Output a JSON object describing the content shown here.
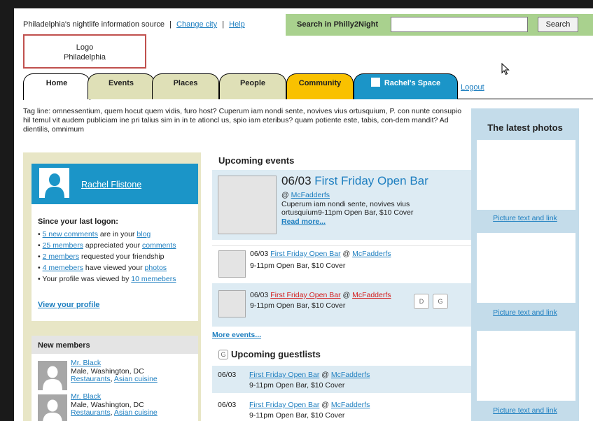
{
  "header": {
    "info_text": "Philadelphia's nightlife information source",
    "separator": "|",
    "change_city": "Change city",
    "help": "Help"
  },
  "search": {
    "label": "Search in Philly2Night",
    "placeholder": "",
    "value": "",
    "button": "Search"
  },
  "logo": {
    "line1": "Logo",
    "line2": "Philadelphia"
  },
  "tabs": [
    {
      "label": "Home",
      "color": "#ffffff"
    },
    {
      "label": "Events",
      "color": "#dfe0b7"
    },
    {
      "label": "Places",
      "color": "#dfe0b7"
    },
    {
      "label": "People",
      "color": "#dfe0b7"
    },
    {
      "label": "Community",
      "color": "#f9c100"
    },
    {
      "label": "Rachel's Space",
      "color": "#1b95c8"
    }
  ],
  "logout": "Logout",
  "tagline": "Tag line: omnessentium, quem hocut quem vidis, furo host? Cuperum iam nondi sente, novives vius ortusquium, P. con nunte consupio hil temul vit audem publiciam ine pri talius sim in in te ationcl us, spio iam eteribus? quam potiente este, tabis, con-dem mandit? Ad dientilis, omnimum",
  "profile": {
    "name": "Rachel Flistone",
    "since_title": "Since your last logon:",
    "items": [
      {
        "link1": "5 new comments",
        "mid": " are in your ",
        "link2": "blog"
      },
      {
        "link1": "25 members",
        "mid": " appreciated your ",
        "link2": "comments"
      },
      {
        "link1": "2 members",
        "mid": " requested your friendship",
        "link2": ""
      },
      {
        "link1": "4 memebers",
        "mid": " have viewed your ",
        "link2": "photos"
      },
      {
        "pre": "Your profile was viewed by ",
        "link1": "10 memebers"
      }
    ],
    "view_profile": "View your profile"
  },
  "new_members": {
    "title": "New members",
    "members": [
      {
        "name": "Mr. Black",
        "info": "Male, Washington, DC",
        "tag1": "Restaurants",
        "sep": ", ",
        "tag2": "Asian cuisine"
      },
      {
        "name": "Mr. Black",
        "info": "Male, Washington, DC",
        "tag1": "Restaurants",
        "sep": ", ",
        "tag2": "Asian cuisine"
      }
    ]
  },
  "upcoming_events": {
    "title": "Upcoming events",
    "featured": {
      "date": "06/03",
      "title": "First Friday Open Bar",
      "at": "@",
      "venue": "McFadderfs",
      "desc": "Cuperum iam nondi sente, novives vius ortusquium9-11pm Open Bar, $10 Cover",
      "read_more": "Read more..."
    },
    "events": [
      {
        "date": "06/03",
        "title": "First Friday Open Bar",
        "at": "@",
        "venue": "McFadderfs",
        "details": "9-11pm Open Bar, $10 Cover"
      },
      {
        "date": "06/03",
        "title": "First Friday Open Bar",
        "at": "@",
        "venue": "McFadderfs",
        "details": "9-11pm Open Bar, $10 Cover",
        "btn_d": "D",
        "btn_g": "G"
      }
    ],
    "more": "More events..."
  },
  "guestlists": {
    "icon": "G",
    "title": "Upcoming guestlists",
    "items": [
      {
        "date": "06/03",
        "title": "First Friday Open Bar",
        "at": "@",
        "venue": "McFadderfs",
        "details": "9-11pm Open Bar, $10 Cover"
      },
      {
        "date": "06/03",
        "title": "First Friday Open Bar",
        "at": "@",
        "venue": "McFadderfs",
        "details": "9-11pm Open Bar, $10 Cover"
      }
    ]
  },
  "photos": {
    "title": "The latest photos",
    "items": [
      {
        "caption": "Picture text and link"
      },
      {
        "caption": "Picture text and link"
      },
      {
        "caption": "Picture text and link"
      }
    ]
  }
}
